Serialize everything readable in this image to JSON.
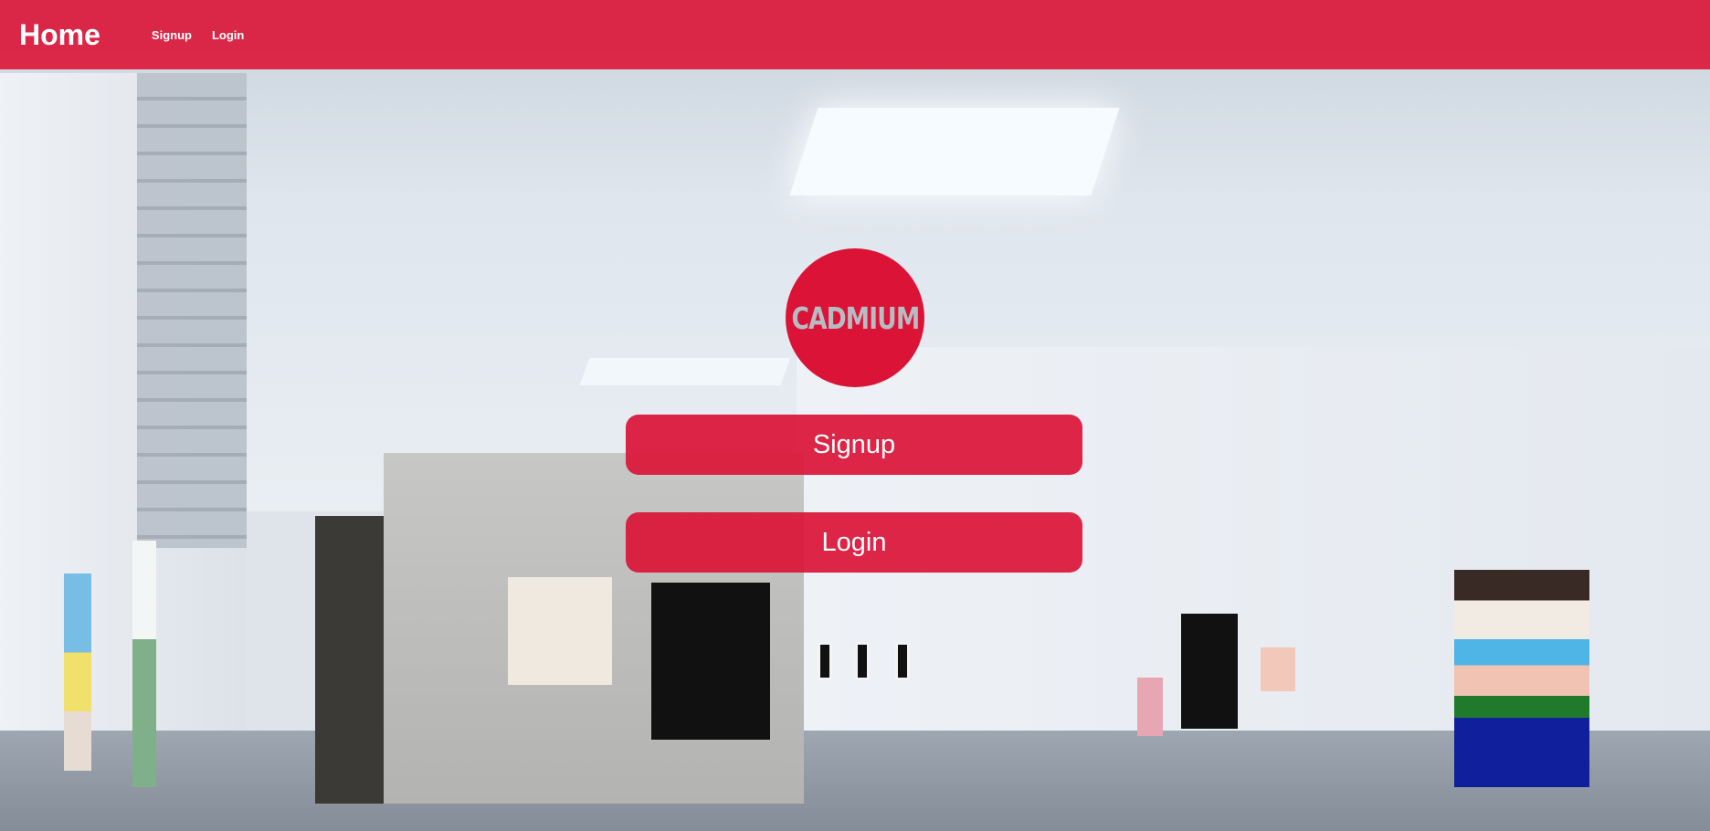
{
  "header": {
    "brand": "Home",
    "nav": {
      "signup": "Signup",
      "login": "Login"
    }
  },
  "main": {
    "logo_text": "CADMIUM",
    "signup_button": "Signup",
    "login_button": "Login"
  },
  "colors": {
    "accent": "#db1437",
    "text": "#ffffff",
    "logo_text": "#b7bcc3"
  }
}
